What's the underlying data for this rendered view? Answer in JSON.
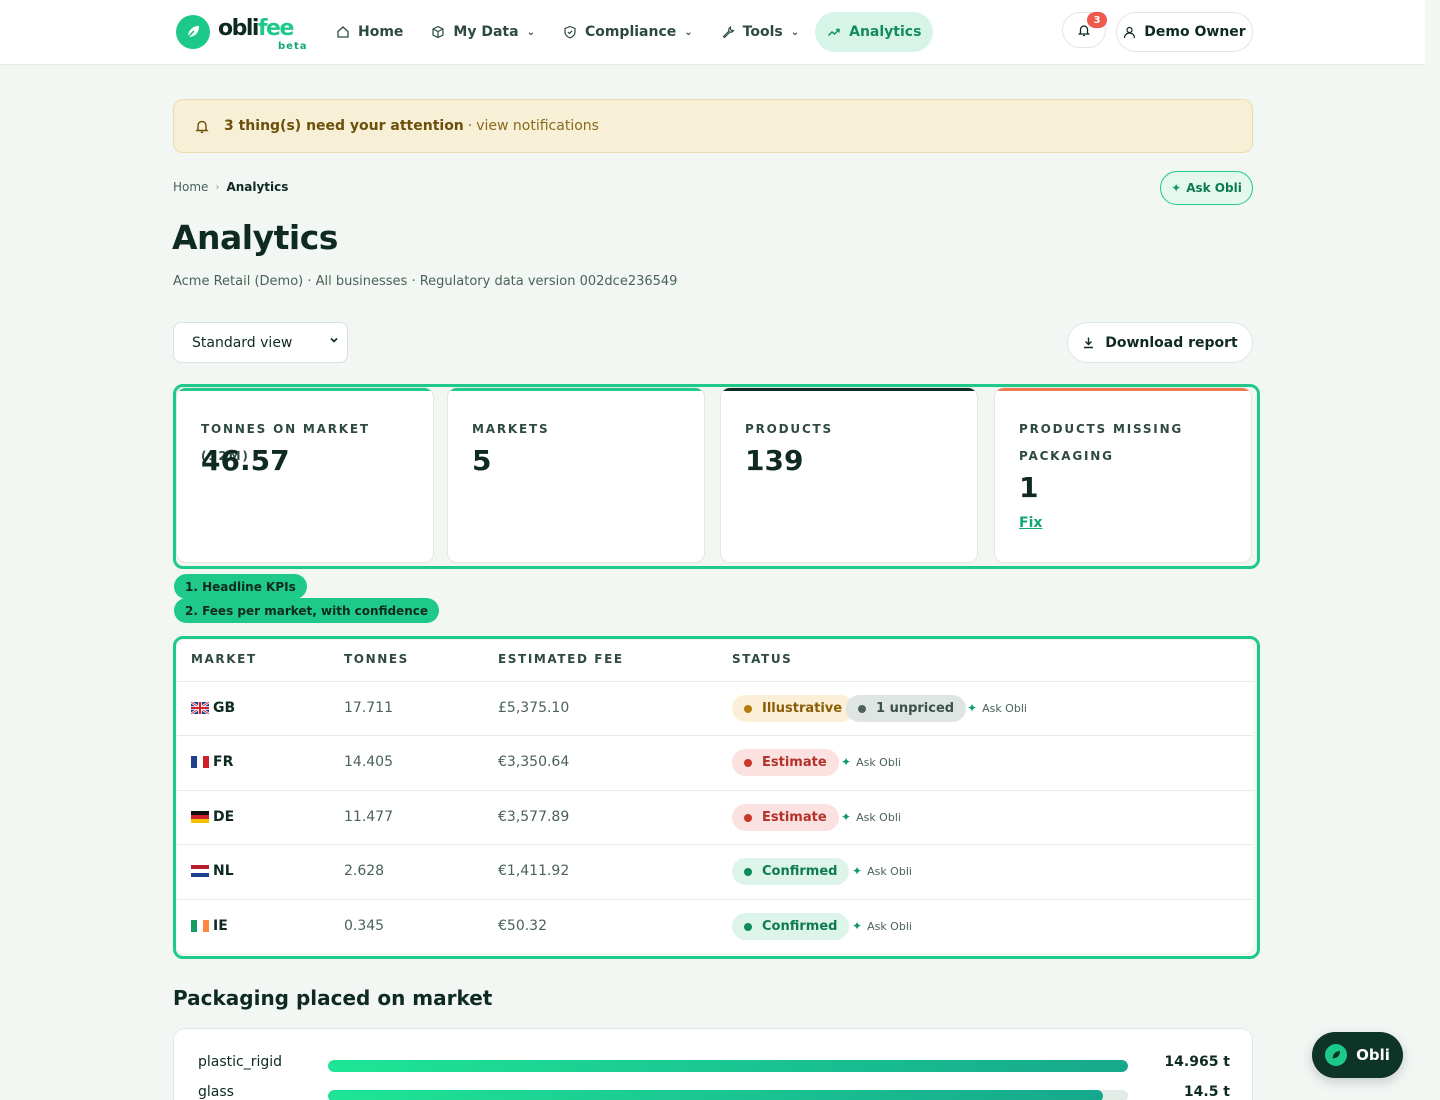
{
  "brand": {
    "name_part1": "obli",
    "name_part2": "fee",
    "badge": "beta"
  },
  "nav": {
    "items": [
      {
        "label": "Home",
        "icon": "home-icon",
        "dropdown": false,
        "active": false
      },
      {
        "label": "My Data",
        "icon": "cube-icon",
        "dropdown": true,
        "active": false
      },
      {
        "label": "Compliance",
        "icon": "shield-icon",
        "dropdown": true,
        "active": false
      },
      {
        "label": "Tools",
        "icon": "wrench-icon",
        "dropdown": true,
        "active": false
      },
      {
        "label": "Analytics",
        "icon": "trend-icon",
        "dropdown": false,
        "active": true
      }
    ]
  },
  "header": {
    "notification_count": "3",
    "user_label": "Demo Owner"
  },
  "alert": {
    "strong": "3 thing(s) need your attention",
    "separator": "·",
    "link": "view notifications"
  },
  "breadcrumb": {
    "home": "Home",
    "current": "Analytics",
    "sep": "›"
  },
  "ask_button": "Ask Obli",
  "page": {
    "title": "Analytics",
    "subtitle": "Acme Retail (Demo) · All businesses · Regulatory data version 002dce236549"
  },
  "controls": {
    "view_selected": "Standard view",
    "download_label": "Download report"
  },
  "kpis": [
    {
      "label": "TONNES ON MARKET (12M)",
      "value": "46.57",
      "stripe": "#1ec98a"
    },
    {
      "label": "MARKETS",
      "value": "5",
      "stripe": "#1ec98a"
    },
    {
      "label": "PRODUCTS",
      "value": "139",
      "stripe": "#0e2a22"
    },
    {
      "label": "PRODUCTS MISSING PACKAGING",
      "value": "1",
      "stripe": "#ef7a4c",
      "action": "Fix"
    }
  ],
  "tour_tags": {
    "tag1": "1. Headline KPIs",
    "tag2": "2. Fees per market, with confidence"
  },
  "fees_table": {
    "headers": {
      "market": "MARKET",
      "tonnes": "TONNES",
      "fee": "ESTIMATED FEE",
      "status": "STATUS"
    },
    "rows": [
      {
        "code": "GB",
        "tonnes": "17.711",
        "fee": "£5,375.10",
        "status": "Illustrative",
        "extra": "1 unpriced",
        "ask": "Ask Obli"
      },
      {
        "code": "FR",
        "tonnes": "14.405",
        "fee": "€3,350.64",
        "status": "Estimate",
        "ask": "Ask Obli"
      },
      {
        "code": "DE",
        "tonnes": "11.477",
        "fee": "€3,577.89",
        "status": "Estimate",
        "ask": "Ask Obli"
      },
      {
        "code": "NL",
        "tonnes": "2.628",
        "fee": "€1,411.92",
        "status": "Confirmed",
        "ask": "Ask Obli"
      },
      {
        "code": "IE",
        "tonnes": "0.345",
        "fee": "€50.32",
        "status": "Confirmed",
        "ask": "Ask Obli"
      }
    ]
  },
  "status_colors": {
    "Illustrative": {
      "bg": "#fbefd8",
      "dot": "#b57c0c",
      "text": "#8a5d05"
    },
    "Estimate": {
      "bg": "#fbe1df",
      "dot": "#c8372a",
      "text": "#b4302a"
    },
    "Confirmed": {
      "bg": "#dcf4ea",
      "dot": "#0f8a5c",
      "text": "#0d7a52"
    },
    "unpriced": {
      "bg": "#dfe5e2",
      "dot": "#4a6259",
      "text": "#3a5249"
    }
  },
  "packaging": {
    "title": "Packaging placed on market",
    "items": [
      {
        "label": "plastic_rigid",
        "value": "14.965 t",
        "fraction": 1.0
      },
      {
        "label": "glass",
        "value": "14.5 t",
        "fraction": 0.969
      }
    ]
  },
  "fab": {
    "label": "Obli"
  }
}
